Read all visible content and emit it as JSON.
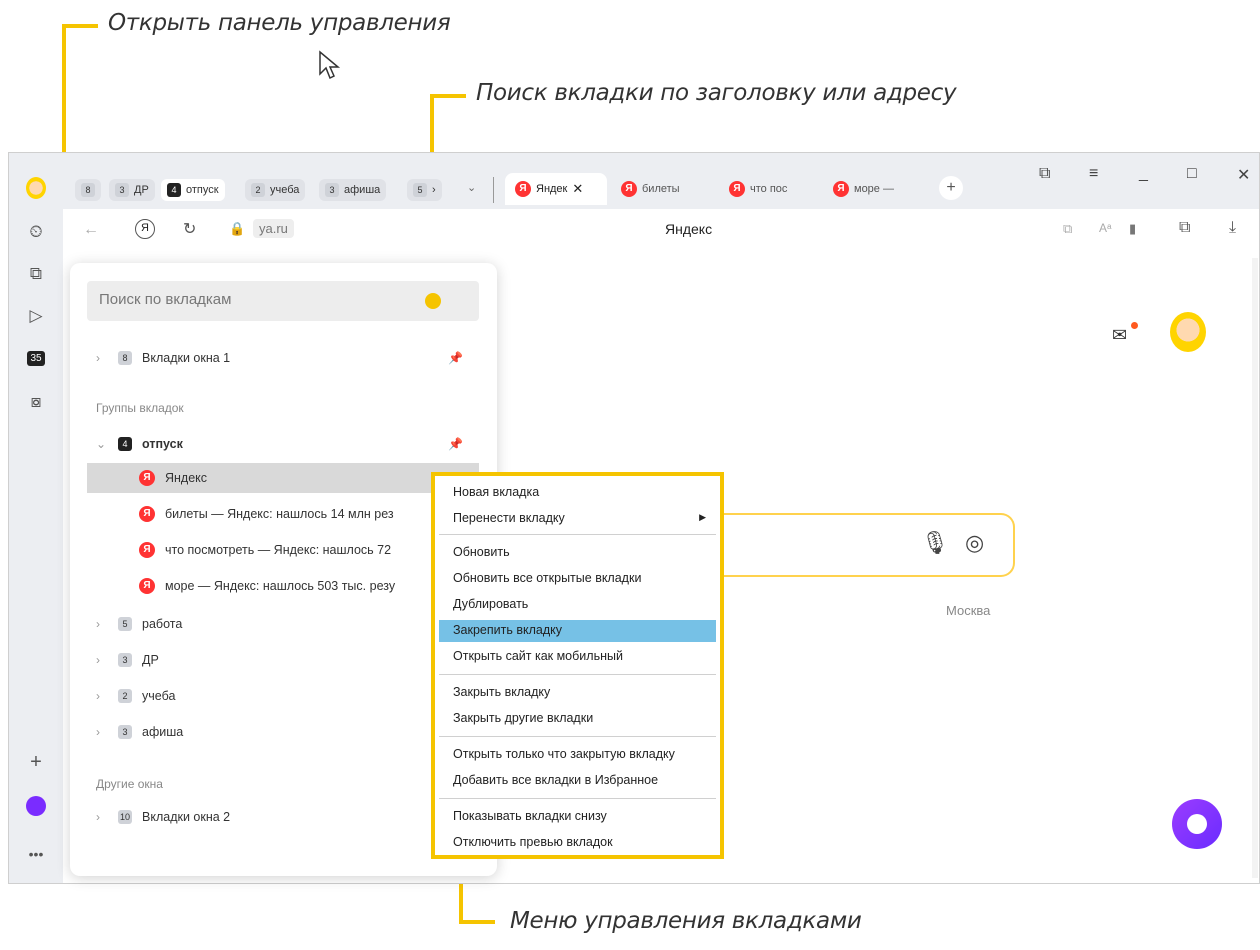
{
  "callouts": {
    "control_panel": "Открыть панель управления",
    "search_tab": "Поиск вкладки по заголовку или адресу",
    "tab_menu": "Меню управления вкладками"
  },
  "tabbar": {
    "groups": [
      {
        "count": "8",
        "label": ""
      },
      {
        "count": "3",
        "label": "ДР"
      },
      {
        "count": "4",
        "label": "отпуск",
        "active": true
      },
      {
        "count": "2",
        "label": "учеба"
      },
      {
        "count": "3",
        "label": "афиша"
      },
      {
        "count": "5",
        "label": ""
      }
    ],
    "tabs": [
      {
        "label": "Яндек",
        "active": true
      },
      {
        "label": "билеты"
      },
      {
        "label": "что пос"
      },
      {
        "label": "море —"
      }
    ],
    "new_tab": "+"
  },
  "toolbar": {
    "address": "ya.ru",
    "page_title": "Яндекс"
  },
  "sidebar": {
    "calendar_day": "35"
  },
  "panel": {
    "search_placeholder": "Поиск по вкладкам",
    "window1": {
      "count": "8",
      "label": "Вкладки окна 1"
    },
    "groups_title": "Группы вкладок",
    "open_group": {
      "count": "4",
      "label": "отпуск"
    },
    "tabs": [
      "Яндекс",
      "билеты — Яндекс: нашлось 14 млн рез",
      "что посмотреть — Яндекс: нашлось 72",
      "море — Яндекс: нашлось 503 тыс. резу"
    ],
    "groups": [
      {
        "count": "5",
        "label": "работа"
      },
      {
        "count": "3",
        "label": "ДР"
      },
      {
        "count": "2",
        "label": "учеба"
      },
      {
        "count": "3",
        "label": "афиша"
      }
    ],
    "other_title": "Другие окна",
    "window2": {
      "count": "10",
      "label": "Вкладки окна 2"
    }
  },
  "page": {
    "city": "Москва"
  },
  "menu": {
    "items": [
      "Новая вкладка",
      "Перенести вкладку",
      "Обновить",
      "Обновить все открытые вкладки",
      "Дублировать",
      "Закрепить вкладку",
      "Открыть сайт как мобильный",
      "Закрыть вкладку",
      "Закрыть другие вкладки",
      "Открыть только что закрытую вкладку",
      "Добавить все вкладки в Избранное",
      "Показывать вкладки снизу",
      "Отключить превью вкладок"
    ],
    "highlighted": "Закрепить вкладку"
  },
  "colors": {
    "accent_yellow": "#f5c400",
    "menu_highlight": "#76c1e6",
    "yandex_red": "#ff3333",
    "alice_purple": "#7a2cff"
  }
}
